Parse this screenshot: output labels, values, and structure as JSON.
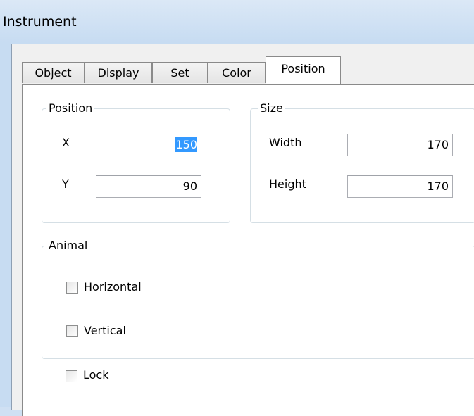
{
  "window": {
    "title": "Instrument"
  },
  "tabs": [
    {
      "label": "Object",
      "active": false
    },
    {
      "label": "Display",
      "active": false
    },
    {
      "label": "Set",
      "active": false
    },
    {
      "label": "Color",
      "active": false
    },
    {
      "label": "Position",
      "active": true
    }
  ],
  "position_group": {
    "legend": "Position",
    "x_label": "X",
    "x_value": "150",
    "y_label": "Y",
    "y_value": "90"
  },
  "size_group": {
    "legend": "Size",
    "width_label": "Width",
    "width_value": "170",
    "height_label": "Height",
    "height_value": "170"
  },
  "animal_group": {
    "legend": "Animal",
    "horizontal_label": "Horizontal",
    "horizontal_checked": false,
    "vertical_label": "Vertical",
    "vertical_checked": false
  },
  "lock": {
    "label": "Lock",
    "checked": false
  },
  "colors": {
    "selection": "#3399ff",
    "group_border": "#d5dfe5"
  }
}
